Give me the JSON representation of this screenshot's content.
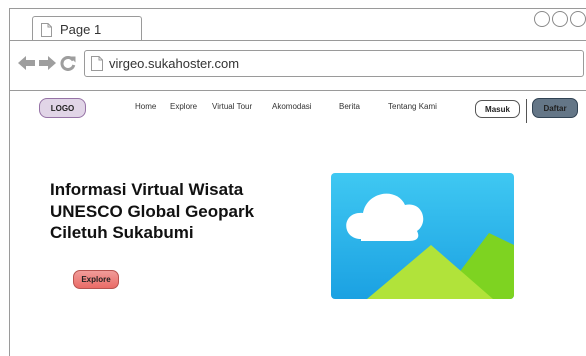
{
  "browser": {
    "tab_title": "Page 1",
    "url": "virgeo.sukahoster.com",
    "icons": [
      "page-icon",
      "back-arrow-icon",
      "forward-arrow-icon",
      "refresh-icon",
      "window-control-circles"
    ]
  },
  "navbar": {
    "logo": "LOGO",
    "links": [
      "Home",
      "Explore",
      "Virtual Tour",
      "Akomodasi",
      "Berita",
      "Tentang Kami"
    ],
    "login_label": "Masuk",
    "register_label": "Daftar"
  },
  "hero": {
    "title": "Informasi Virtual Wisata UNESCO Global Geopark Ciletuh Sukabumi",
    "explore_label": "Explore",
    "image_icon": "image-placeholder-icon"
  },
  "colors": {
    "logo_fill": "#e1d5e7",
    "logo_border": "#9673a6",
    "daftar_fill": "#647687",
    "explore_fill": "#ea6b66",
    "sky": "#1ba1e2",
    "hill_light": "#b1e33a",
    "hill_dark": "#7ed321"
  }
}
